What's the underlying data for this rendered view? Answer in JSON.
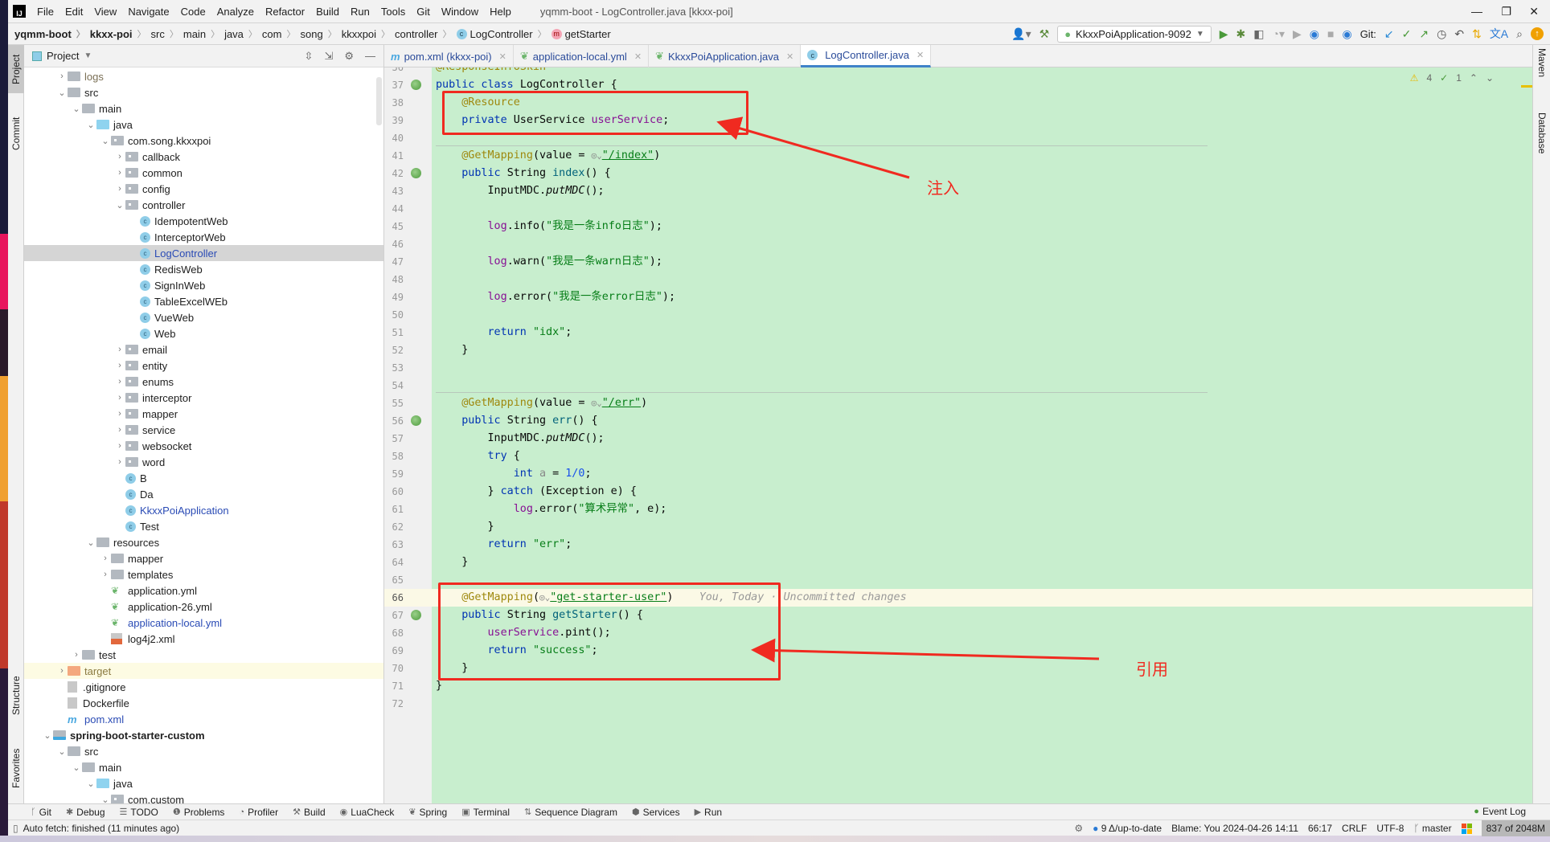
{
  "window": {
    "title": "yqmm-boot - LogController.java [kkxx-poi]",
    "logo": "IJ"
  },
  "menu": [
    "File",
    "Edit",
    "View",
    "Navigate",
    "Code",
    "Analyze",
    "Refactor",
    "Build",
    "Run",
    "Tools",
    "Git",
    "Window",
    "Help"
  ],
  "breadcrumb": [
    {
      "label": "yqmm-boot",
      "bold": true
    },
    {
      "label": "kkxx-poi",
      "bold": true
    },
    {
      "label": "src"
    },
    {
      "label": "main"
    },
    {
      "label": "java"
    },
    {
      "label": "com"
    },
    {
      "label": "song"
    },
    {
      "label": "kkxxpoi"
    },
    {
      "label": "controller"
    },
    {
      "label": "LogController",
      "icon": "class-icon"
    },
    {
      "label": "getStarter",
      "icon": "method-icon"
    }
  ],
  "toolbar": {
    "run_config": "KkxxPoiApplication-9092",
    "git_label": "Git:"
  },
  "left_stripe": [
    "Project",
    "Commit",
    "Structure",
    "Favorites"
  ],
  "right_stripe": [
    "Maven",
    "Database"
  ],
  "project": {
    "title": "Project",
    "tree": [
      {
        "d": 1,
        "a": "closed",
        "i": "folder",
        "label": "logs",
        "color": "#7a6f55"
      },
      {
        "d": 1,
        "a": "open",
        "i": "folder",
        "label": "src"
      },
      {
        "d": 2,
        "a": "open",
        "i": "folder",
        "label": "main"
      },
      {
        "d": 3,
        "a": "open",
        "i": "folder-src",
        "label": "java"
      },
      {
        "d": 4,
        "a": "open",
        "i": "package",
        "label": "com.song.kkxxpoi"
      },
      {
        "d": 5,
        "a": "closed",
        "i": "package",
        "label": "callback"
      },
      {
        "d": 5,
        "a": "closed",
        "i": "package",
        "label": "common"
      },
      {
        "d": 5,
        "a": "closed",
        "i": "package",
        "label": "config"
      },
      {
        "d": 5,
        "a": "open",
        "i": "package",
        "label": "controller"
      },
      {
        "d": 6,
        "a": "none",
        "i": "class",
        "label": "IdempotentWeb"
      },
      {
        "d": 6,
        "a": "none",
        "i": "class",
        "label": "InterceptorWeb"
      },
      {
        "d": 6,
        "a": "none",
        "i": "class",
        "label": "LogController",
        "color": "#2a4bb5",
        "selected": true
      },
      {
        "d": 6,
        "a": "none",
        "i": "class",
        "label": "RedisWeb"
      },
      {
        "d": 6,
        "a": "none",
        "i": "class",
        "label": "SignInWeb"
      },
      {
        "d": 6,
        "a": "none",
        "i": "class",
        "label": "TableExcelWEb"
      },
      {
        "d": 6,
        "a": "none",
        "i": "class",
        "label": "VueWeb"
      },
      {
        "d": 6,
        "a": "none",
        "i": "class",
        "label": "Web"
      },
      {
        "d": 5,
        "a": "closed",
        "i": "package",
        "label": "email"
      },
      {
        "d": 5,
        "a": "closed",
        "i": "package",
        "label": "entity"
      },
      {
        "d": 5,
        "a": "closed",
        "i": "package",
        "label": "enums"
      },
      {
        "d": 5,
        "a": "closed",
        "i": "package",
        "label": "interceptor"
      },
      {
        "d": 5,
        "a": "closed",
        "i": "package",
        "label": "mapper"
      },
      {
        "d": 5,
        "a": "closed",
        "i": "package",
        "label": "service"
      },
      {
        "d": 5,
        "a": "closed",
        "i": "package",
        "label": "websocket"
      },
      {
        "d": 5,
        "a": "closed",
        "i": "package",
        "label": "word"
      },
      {
        "d": 5,
        "a": "none",
        "i": "class",
        "label": "B"
      },
      {
        "d": 5,
        "a": "none",
        "i": "class",
        "label": "Da"
      },
      {
        "d": 5,
        "a": "none",
        "i": "class",
        "label": "KkxxPoiApplication",
        "color": "#2a4bb5"
      },
      {
        "d": 5,
        "a": "none",
        "i": "class",
        "label": "Test"
      },
      {
        "d": 3,
        "a": "open",
        "i": "folder",
        "label": "resources"
      },
      {
        "d": 4,
        "a": "closed",
        "i": "folder",
        "label": "mapper"
      },
      {
        "d": 4,
        "a": "closed",
        "i": "folder",
        "label": "templates"
      },
      {
        "d": 4,
        "a": "none",
        "i": "yml",
        "label": "application.yml"
      },
      {
        "d": 4,
        "a": "none",
        "i": "yml",
        "label": "application-26.yml"
      },
      {
        "d": 4,
        "a": "none",
        "i": "yml",
        "label": "application-local.yml",
        "color": "#2a4bb5"
      },
      {
        "d": 4,
        "a": "none",
        "i": "xml",
        "label": "log4j2.xml"
      },
      {
        "d": 2,
        "a": "closed",
        "i": "folder",
        "label": "test"
      },
      {
        "d": 1,
        "a": "closed",
        "i": "folder-orange",
        "label": "target",
        "color": "#8a7a40",
        "highlight": true
      },
      {
        "d": 1,
        "a": "none",
        "i": "file",
        "label": ".gitignore"
      },
      {
        "d": 1,
        "a": "none",
        "i": "file",
        "label": "Dockerfile"
      },
      {
        "d": 1,
        "a": "none",
        "i": "maven",
        "label": "pom.xml",
        "color": "#2a4bb5"
      },
      {
        "d": 0,
        "a": "open",
        "i": "module",
        "label": "spring-boot-starter-custom",
        "bold": true
      },
      {
        "d": 1,
        "a": "open",
        "i": "folder",
        "label": "src"
      },
      {
        "d": 2,
        "a": "open",
        "i": "folder",
        "label": "main"
      },
      {
        "d": 3,
        "a": "open",
        "i": "folder-src",
        "label": "java"
      },
      {
        "d": 4,
        "a": "open",
        "i": "package",
        "label": "com.custom"
      }
    ]
  },
  "tabs": [
    {
      "label": "pom.xml (kkxx-poi)",
      "icon": "maven-icon"
    },
    {
      "label": "application-local.yml",
      "icon": "spring-yml-icon"
    },
    {
      "label": "KkxxPoiApplication.java",
      "icon": "spring-class-icon"
    },
    {
      "label": "LogController.java",
      "icon": "class-icon",
      "active": true
    }
  ],
  "inspections": {
    "warnings": "4",
    "weak_warnings": "1"
  },
  "code": [
    {
      "n": "36",
      "t": [
        [
          "ann",
          "@ResponseInfoSkin"
        ]
      ]
    },
    {
      "n": "37",
      "bean": true,
      "t": [
        [
          "kw",
          "public class "
        ],
        [
          "",
          "LogController {"
        ]
      ]
    },
    {
      "n": "38",
      "t": [
        [
          "",
          "    "
        ],
        [
          "ann",
          "@Resource"
        ]
      ]
    },
    {
      "n": "39",
      "t": [
        [
          "",
          "    "
        ],
        [
          "kw",
          "private "
        ],
        [
          "",
          "UserService "
        ],
        [
          "fld",
          "userService"
        ],
        [
          "",
          ";"
        ]
      ]
    },
    {
      "n": "40",
      "t": []
    },
    {
      "n": "41",
      "t": [
        [
          "",
          "    "
        ],
        [
          "ann",
          "@GetMapping"
        ],
        [
          "",
          "(value = "
        ],
        [
          "hint",
          "◎⌄"
        ],
        [
          "str",
          "\"/index\""
        ],
        [
          "",
          ")"
        ]
      ]
    },
    {
      "n": "42",
      "bean": true,
      "t": [
        [
          "",
          "    "
        ],
        [
          "kw",
          "public "
        ],
        [
          "",
          "String "
        ],
        [
          "fn",
          "index"
        ],
        [
          "",
          "() {"
        ]
      ]
    },
    {
      "n": "43",
      "t": [
        [
          "",
          "        InputMDC."
        ],
        [
          "it",
          "putMDC"
        ],
        [
          "",
          "();"
        ]
      ]
    },
    {
      "n": "44",
      "t": []
    },
    {
      "n": "45",
      "t": [
        [
          "",
          "        "
        ],
        [
          "fld",
          "log"
        ],
        [
          "",
          ".info("
        ],
        [
          "str",
          "\"我是一条info日志\""
        ],
        [
          "",
          ");"
        ]
      ]
    },
    {
      "n": "46",
      "t": []
    },
    {
      "n": "47",
      "t": [
        [
          "",
          "        "
        ],
        [
          "fld",
          "log"
        ],
        [
          "",
          ".warn("
        ],
        [
          "str",
          "\"我是一条warn日志\""
        ],
        [
          "",
          ");"
        ]
      ]
    },
    {
      "n": "48",
      "t": []
    },
    {
      "n": "49",
      "t": [
        [
          "",
          "        "
        ],
        [
          "fld",
          "log"
        ],
        [
          "",
          ".error("
        ],
        [
          "str",
          "\"我是一条error日志\""
        ],
        [
          "",
          ");"
        ]
      ]
    },
    {
      "n": "50",
      "t": []
    },
    {
      "n": "51",
      "t": [
        [
          "",
          "        "
        ],
        [
          "kw",
          "return "
        ],
        [
          "str",
          "\"idx\""
        ],
        [
          "",
          ";"
        ]
      ]
    },
    {
      "n": "52",
      "t": [
        [
          "",
          "    }"
        ]
      ]
    },
    {
      "n": "53",
      "t": []
    },
    {
      "n": "54",
      "t": []
    },
    {
      "n": "55",
      "t": [
        [
          "",
          "    "
        ],
        [
          "ann",
          "@GetMapping"
        ],
        [
          "",
          "(value = "
        ],
        [
          "hint",
          "◎⌄"
        ],
        [
          "str",
          "\"/err\""
        ],
        [
          "",
          ")"
        ]
      ]
    },
    {
      "n": "56",
      "bean": true,
      "t": [
        [
          "",
          "    "
        ],
        [
          "kw",
          "public "
        ],
        [
          "",
          "String "
        ],
        [
          "fn",
          "err"
        ],
        [
          "",
          "() {"
        ]
      ]
    },
    {
      "n": "57",
      "t": [
        [
          "",
          "        InputMDC."
        ],
        [
          "it",
          "putMDC"
        ],
        [
          "",
          "();"
        ]
      ]
    },
    {
      "n": "58",
      "t": [
        [
          "",
          "        "
        ],
        [
          "kw",
          "try "
        ],
        [
          "",
          "{"
        ]
      ]
    },
    {
      "n": "59",
      "t": [
        [
          "",
          "            "
        ],
        [
          "kw",
          "int "
        ],
        [
          "var",
          "a"
        ],
        [
          "",
          " = "
        ],
        [
          "num",
          "1/0"
        ],
        [
          "",
          ";"
        ]
      ]
    },
    {
      "n": "60",
      "t": [
        [
          "",
          "        } "
        ],
        [
          "kw",
          "catch "
        ],
        [
          "",
          "(Exception e) {"
        ]
      ]
    },
    {
      "n": "61",
      "t": [
        [
          "",
          "            "
        ],
        [
          "fld",
          "log"
        ],
        [
          "",
          ".error("
        ],
        [
          "str",
          "\"算术异常\""
        ],
        [
          "",
          ", e);"
        ]
      ]
    },
    {
      "n": "62",
      "t": [
        [
          "",
          "        }"
        ]
      ]
    },
    {
      "n": "63",
      "t": [
        [
          "",
          "        "
        ],
        [
          "kw",
          "return "
        ],
        [
          "str",
          "\"err\""
        ],
        [
          "",
          ";"
        ]
      ]
    },
    {
      "n": "64",
      "t": [
        [
          "",
          "    }"
        ]
      ]
    },
    {
      "n": "65",
      "t": []
    },
    {
      "n": "66",
      "current": true,
      "t": [
        [
          "",
          "    "
        ],
        [
          "ann",
          "@GetMapping"
        ],
        [
          "",
          "("
        ],
        [
          "hint",
          "◎⌄"
        ],
        [
          "str",
          "\"get-starter-user\""
        ],
        [
          "",
          ")"
        ],
        [
          "",
          "    "
        ],
        [
          "blame",
          "You, Today · Uncommitted changes"
        ]
      ]
    },
    {
      "n": "67",
      "bean": true,
      "t": [
        [
          "",
          "    "
        ],
        [
          "kw",
          "public "
        ],
        [
          "",
          "String "
        ],
        [
          "fn",
          "getStarter"
        ],
        [
          "",
          "() {"
        ]
      ]
    },
    {
      "n": "68",
      "t": [
        [
          "",
          "        "
        ],
        [
          "fld",
          "userService"
        ],
        [
          "",
          ".pint();"
        ]
      ]
    },
    {
      "n": "69",
      "t": [
        [
          "",
          "        "
        ],
        [
          "kw",
          "return "
        ],
        [
          "str",
          "\"success\""
        ],
        [
          "",
          ";"
        ]
      ]
    },
    {
      "n": "70",
      "t": [
        [
          "",
          "    }"
        ]
      ]
    },
    {
      "n": "71",
      "t": [
        [
          "",
          "}"
        ]
      ]
    },
    {
      "n": "72",
      "t": []
    }
  ],
  "annotations": {
    "inject": "注入",
    "reference": "引用",
    "color": "#f02a20"
  },
  "bottom_tools": [
    "Git",
    "Debug",
    "TODO",
    "Problems",
    "Profiler",
    "Build",
    "LuaCheck",
    "Spring",
    "Terminal",
    "Sequence Diagram",
    "Services",
    "Run"
  ],
  "event_log": "Event Log",
  "status": {
    "message": "Auto fetch: finished (11 minutes ago)",
    "vcs": "9 Δ/up-to-date",
    "blame": "Blame: You 2024-04-26 14:11",
    "position": "66:17",
    "line_sep": "CRLF",
    "encoding": "UTF-8",
    "branch": "master",
    "memory": "837 of 2048M"
  }
}
